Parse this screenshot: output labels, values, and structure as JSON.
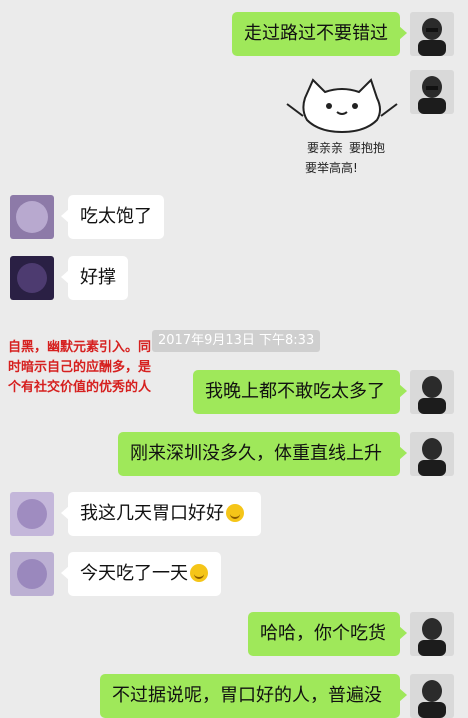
{
  "messages": [
    {
      "side": "right",
      "text": "走过路过不要错过"
    },
    {
      "side": "right",
      "type": "sticker",
      "sticker_text": [
        "要亲亲",
        "要抱抱",
        "要举高高!"
      ]
    },
    {
      "side": "left",
      "text": "吃太饱了"
    },
    {
      "side": "left",
      "text": "好撑"
    },
    {
      "side": "right",
      "text": "我晚上都不敢吃太多了"
    },
    {
      "side": "right",
      "text": "刚来深圳没多久，体重直线上升"
    },
    {
      "side": "left",
      "text": "我这几天胃口好好"
    },
    {
      "side": "left",
      "text": "今天吃了一天"
    },
    {
      "side": "right",
      "text": "哈哈，你个吃货"
    },
    {
      "side": "right",
      "text": "不过据说呢，胃口好的人，普遍没"
    }
  ],
  "timestamp": "2017年9月13日 下午8:33",
  "annotation": "自黑，幽默元素引入。同时暗示自己的应酬多，是个有社交价值的优秀的人",
  "colors": {
    "background": "#ebebeb",
    "bubble_green": "#9fe85a",
    "bubble_white": "#ffffff",
    "annotation_red": "#d6201f"
  }
}
